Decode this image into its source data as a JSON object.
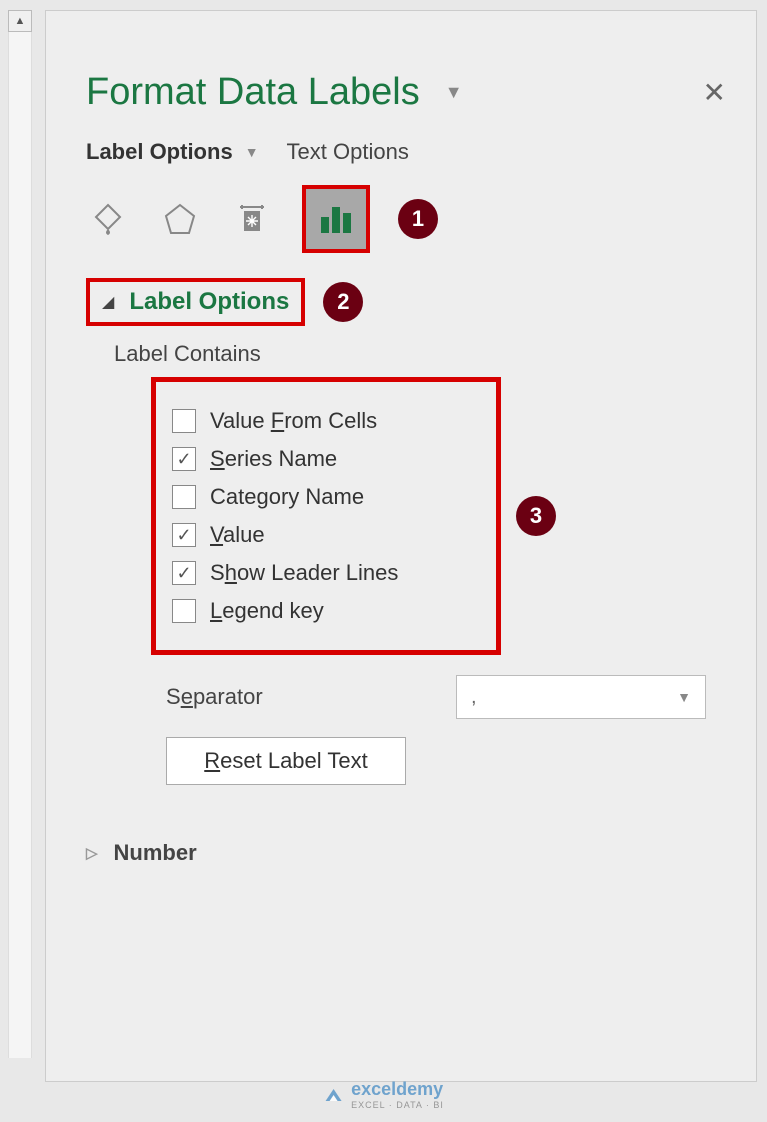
{
  "pane": {
    "title": "Format Data Labels"
  },
  "tabs": {
    "labelOptions": "Label Options",
    "textOptions": "Text Options"
  },
  "badges": {
    "b1": "1",
    "b2": "2",
    "b3": "3"
  },
  "section": {
    "labelOptions": "Label Options",
    "labelContains": "Label Contains"
  },
  "checks": {
    "valueFromCells": {
      "pre": "Value ",
      "u": "F",
      "post": "rom Cells",
      "checked": false
    },
    "seriesName": {
      "pre": "",
      "u": "S",
      "post": "eries Name",
      "checked": true
    },
    "categoryName": {
      "pre": "Cate",
      "u": "g",
      "post": "ory Name",
      "checked": false
    },
    "value": {
      "pre": "",
      "u": "V",
      "post": "alue",
      "checked": true
    },
    "showLeader": {
      "pre": "S",
      "u": "h",
      "post": "ow Leader Lines",
      "checked": true
    },
    "legendKey": {
      "pre": "",
      "u": "L",
      "post": "egend key",
      "checked": false
    }
  },
  "separator": {
    "labelPre": "S",
    "labelU": "e",
    "labelPost": "parator",
    "value": ","
  },
  "reset": {
    "pre": "",
    "u": "R",
    "post": "eset Label Text"
  },
  "number": {
    "label": "Number"
  },
  "watermark": {
    "brand": "exceldemy",
    "tag": "EXCEL · DATA · BI"
  }
}
